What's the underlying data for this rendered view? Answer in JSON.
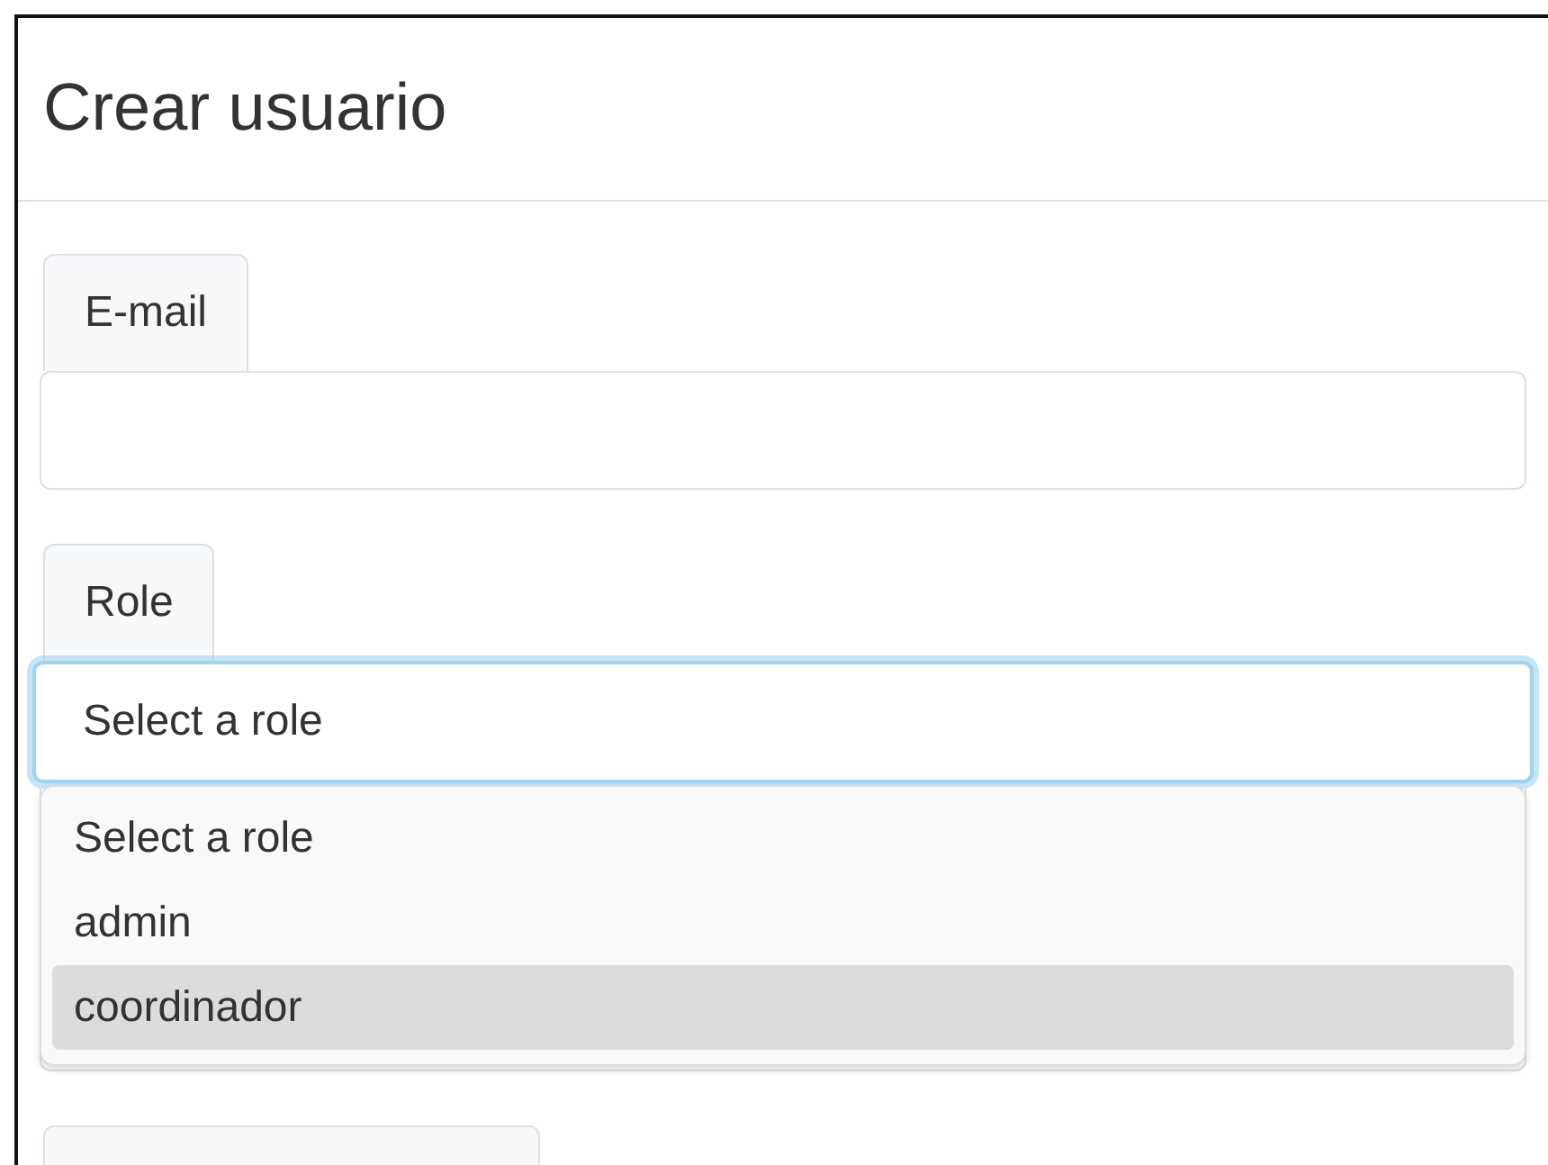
{
  "title": "Crear usuario",
  "fields": [
    {
      "kind": "text",
      "label": "E-mail"
    },
    {
      "kind": "select",
      "label": "Role",
      "value": "Select a role",
      "focused": true,
      "expanded": true,
      "options": [
        {
          "label": "Select a role",
          "highlighted": false
        },
        {
          "label": "admin",
          "highlighted": false
        },
        {
          "label": "coordinador",
          "highlighted": true
        }
      ]
    }
  ]
}
